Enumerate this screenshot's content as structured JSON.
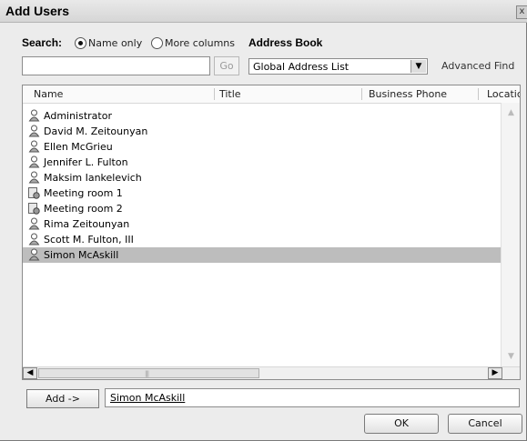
{
  "window": {
    "title": "Add Users",
    "close_glyph": "x"
  },
  "search": {
    "label": "Search:",
    "options": [
      {
        "label": "Name only",
        "selected": true
      },
      {
        "label": "More columns",
        "selected": false
      }
    ],
    "input_value": "",
    "go_label": "Go"
  },
  "address_book": {
    "label": "Address Book",
    "selected": "Global Address List",
    "advanced_find_label": "Advanced Find"
  },
  "list": {
    "columns": [
      "Name",
      "Title",
      "Business Phone",
      "Locatic"
    ],
    "rows": [
      {
        "name": "Administrator",
        "icon": "user-icon",
        "selected": false
      },
      {
        "name": "David M. Zeitounyan",
        "icon": "user-icon",
        "selected": false
      },
      {
        "name": "Ellen McGrieu",
        "icon": "user-icon",
        "selected": false
      },
      {
        "name": "Jennifer L. Fulton",
        "icon": "user-icon",
        "selected": false
      },
      {
        "name": "Maksim Iankelevich",
        "icon": "user-icon",
        "selected": false
      },
      {
        "name": "Meeting room 1",
        "icon": "room-icon",
        "selected": false
      },
      {
        "name": "Meeting room 2",
        "icon": "room-icon",
        "selected": false
      },
      {
        "name": "Rima Zeitounyan",
        "icon": "user-icon",
        "selected": false
      },
      {
        "name": "Scott M. Fulton, III",
        "icon": "user-icon",
        "selected": false
      },
      {
        "name": "Simon McAskill",
        "icon": "user-icon",
        "selected": true
      }
    ]
  },
  "add": {
    "button_label": "Add ->",
    "value": "Simon McAskill"
  },
  "footer": {
    "ok_label": "OK",
    "cancel_label": "Cancel"
  }
}
